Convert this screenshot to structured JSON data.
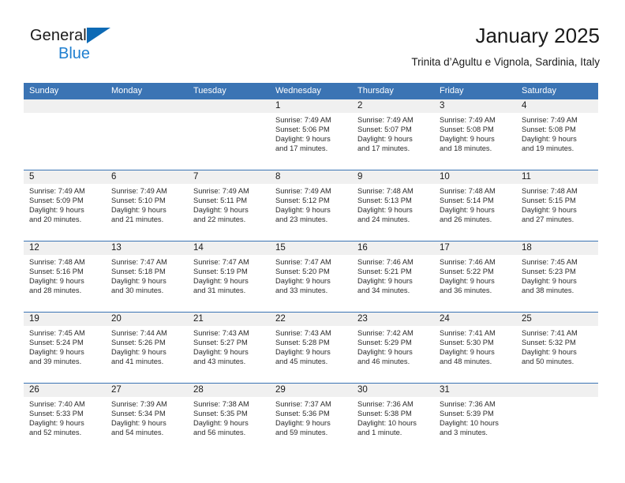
{
  "brand": {
    "name_part1": "General",
    "name_part2": "Blue",
    "color_dark": "#1b1b1b",
    "color_blue": "#1f7fd0",
    "triangle_color": "#0d6ab5"
  },
  "header": {
    "title": "January 2025",
    "subtitle": "Trinita d’Agultu e Vignola, Sardinia, Italy"
  },
  "theme": {
    "header_blue": "#3b74b4",
    "daynum_bg": "#f0f0f0",
    "text": "#1b1b1b"
  },
  "weekdays": [
    "Sunday",
    "Monday",
    "Tuesday",
    "Wednesday",
    "Thursday",
    "Friday",
    "Saturday"
  ],
  "weeks": [
    [
      {
        "day": "",
        "sunrise": "",
        "sunset": "",
        "daylight1": "",
        "daylight2": ""
      },
      {
        "day": "",
        "sunrise": "",
        "sunset": "",
        "daylight1": "",
        "daylight2": ""
      },
      {
        "day": "",
        "sunrise": "",
        "sunset": "",
        "daylight1": "",
        "daylight2": ""
      },
      {
        "day": "1",
        "sunrise": "Sunrise: 7:49 AM",
        "sunset": "Sunset: 5:06 PM",
        "daylight1": "Daylight: 9 hours",
        "daylight2": "and 17 minutes."
      },
      {
        "day": "2",
        "sunrise": "Sunrise: 7:49 AM",
        "sunset": "Sunset: 5:07 PM",
        "daylight1": "Daylight: 9 hours",
        "daylight2": "and 17 minutes."
      },
      {
        "day": "3",
        "sunrise": "Sunrise: 7:49 AM",
        "sunset": "Sunset: 5:08 PM",
        "daylight1": "Daylight: 9 hours",
        "daylight2": "and 18 minutes."
      },
      {
        "day": "4",
        "sunrise": "Sunrise: 7:49 AM",
        "sunset": "Sunset: 5:08 PM",
        "daylight1": "Daylight: 9 hours",
        "daylight2": "and 19 minutes."
      }
    ],
    [
      {
        "day": "5",
        "sunrise": "Sunrise: 7:49 AM",
        "sunset": "Sunset: 5:09 PM",
        "daylight1": "Daylight: 9 hours",
        "daylight2": "and 20 minutes."
      },
      {
        "day": "6",
        "sunrise": "Sunrise: 7:49 AM",
        "sunset": "Sunset: 5:10 PM",
        "daylight1": "Daylight: 9 hours",
        "daylight2": "and 21 minutes."
      },
      {
        "day": "7",
        "sunrise": "Sunrise: 7:49 AM",
        "sunset": "Sunset: 5:11 PM",
        "daylight1": "Daylight: 9 hours",
        "daylight2": "and 22 minutes."
      },
      {
        "day": "8",
        "sunrise": "Sunrise: 7:49 AM",
        "sunset": "Sunset: 5:12 PM",
        "daylight1": "Daylight: 9 hours",
        "daylight2": "and 23 minutes."
      },
      {
        "day": "9",
        "sunrise": "Sunrise: 7:48 AM",
        "sunset": "Sunset: 5:13 PM",
        "daylight1": "Daylight: 9 hours",
        "daylight2": "and 24 minutes."
      },
      {
        "day": "10",
        "sunrise": "Sunrise: 7:48 AM",
        "sunset": "Sunset: 5:14 PM",
        "daylight1": "Daylight: 9 hours",
        "daylight2": "and 26 minutes."
      },
      {
        "day": "11",
        "sunrise": "Sunrise: 7:48 AM",
        "sunset": "Sunset: 5:15 PM",
        "daylight1": "Daylight: 9 hours",
        "daylight2": "and 27 minutes."
      }
    ],
    [
      {
        "day": "12",
        "sunrise": "Sunrise: 7:48 AM",
        "sunset": "Sunset: 5:16 PM",
        "daylight1": "Daylight: 9 hours",
        "daylight2": "and 28 minutes."
      },
      {
        "day": "13",
        "sunrise": "Sunrise: 7:47 AM",
        "sunset": "Sunset: 5:18 PM",
        "daylight1": "Daylight: 9 hours",
        "daylight2": "and 30 minutes."
      },
      {
        "day": "14",
        "sunrise": "Sunrise: 7:47 AM",
        "sunset": "Sunset: 5:19 PM",
        "daylight1": "Daylight: 9 hours",
        "daylight2": "and 31 minutes."
      },
      {
        "day": "15",
        "sunrise": "Sunrise: 7:47 AM",
        "sunset": "Sunset: 5:20 PM",
        "daylight1": "Daylight: 9 hours",
        "daylight2": "and 33 minutes."
      },
      {
        "day": "16",
        "sunrise": "Sunrise: 7:46 AM",
        "sunset": "Sunset: 5:21 PM",
        "daylight1": "Daylight: 9 hours",
        "daylight2": "and 34 minutes."
      },
      {
        "day": "17",
        "sunrise": "Sunrise: 7:46 AM",
        "sunset": "Sunset: 5:22 PM",
        "daylight1": "Daylight: 9 hours",
        "daylight2": "and 36 minutes."
      },
      {
        "day": "18",
        "sunrise": "Sunrise: 7:45 AM",
        "sunset": "Sunset: 5:23 PM",
        "daylight1": "Daylight: 9 hours",
        "daylight2": "and 38 minutes."
      }
    ],
    [
      {
        "day": "19",
        "sunrise": "Sunrise: 7:45 AM",
        "sunset": "Sunset: 5:24 PM",
        "daylight1": "Daylight: 9 hours",
        "daylight2": "and 39 minutes."
      },
      {
        "day": "20",
        "sunrise": "Sunrise: 7:44 AM",
        "sunset": "Sunset: 5:26 PM",
        "daylight1": "Daylight: 9 hours",
        "daylight2": "and 41 minutes."
      },
      {
        "day": "21",
        "sunrise": "Sunrise: 7:43 AM",
        "sunset": "Sunset: 5:27 PM",
        "daylight1": "Daylight: 9 hours",
        "daylight2": "and 43 minutes."
      },
      {
        "day": "22",
        "sunrise": "Sunrise: 7:43 AM",
        "sunset": "Sunset: 5:28 PM",
        "daylight1": "Daylight: 9 hours",
        "daylight2": "and 45 minutes."
      },
      {
        "day": "23",
        "sunrise": "Sunrise: 7:42 AM",
        "sunset": "Sunset: 5:29 PM",
        "daylight1": "Daylight: 9 hours",
        "daylight2": "and 46 minutes."
      },
      {
        "day": "24",
        "sunrise": "Sunrise: 7:41 AM",
        "sunset": "Sunset: 5:30 PM",
        "daylight1": "Daylight: 9 hours",
        "daylight2": "and 48 minutes."
      },
      {
        "day": "25",
        "sunrise": "Sunrise: 7:41 AM",
        "sunset": "Sunset: 5:32 PM",
        "daylight1": "Daylight: 9 hours",
        "daylight2": "and 50 minutes."
      }
    ],
    [
      {
        "day": "26",
        "sunrise": "Sunrise: 7:40 AM",
        "sunset": "Sunset: 5:33 PM",
        "daylight1": "Daylight: 9 hours",
        "daylight2": "and 52 minutes."
      },
      {
        "day": "27",
        "sunrise": "Sunrise: 7:39 AM",
        "sunset": "Sunset: 5:34 PM",
        "daylight1": "Daylight: 9 hours",
        "daylight2": "and 54 minutes."
      },
      {
        "day": "28",
        "sunrise": "Sunrise: 7:38 AM",
        "sunset": "Sunset: 5:35 PM",
        "daylight1": "Daylight: 9 hours",
        "daylight2": "and 56 minutes."
      },
      {
        "day": "29",
        "sunrise": "Sunrise: 7:37 AM",
        "sunset": "Sunset: 5:36 PM",
        "daylight1": "Daylight: 9 hours",
        "daylight2": "and 59 minutes."
      },
      {
        "day": "30",
        "sunrise": "Sunrise: 7:36 AM",
        "sunset": "Sunset: 5:38 PM",
        "daylight1": "Daylight: 10 hours",
        "daylight2": "and 1 minute."
      },
      {
        "day": "31",
        "sunrise": "Sunrise: 7:36 AM",
        "sunset": "Sunset: 5:39 PM",
        "daylight1": "Daylight: 10 hours",
        "daylight2": "and 3 minutes."
      },
      {
        "day": "",
        "sunrise": "",
        "sunset": "",
        "daylight1": "",
        "daylight2": ""
      }
    ]
  ]
}
